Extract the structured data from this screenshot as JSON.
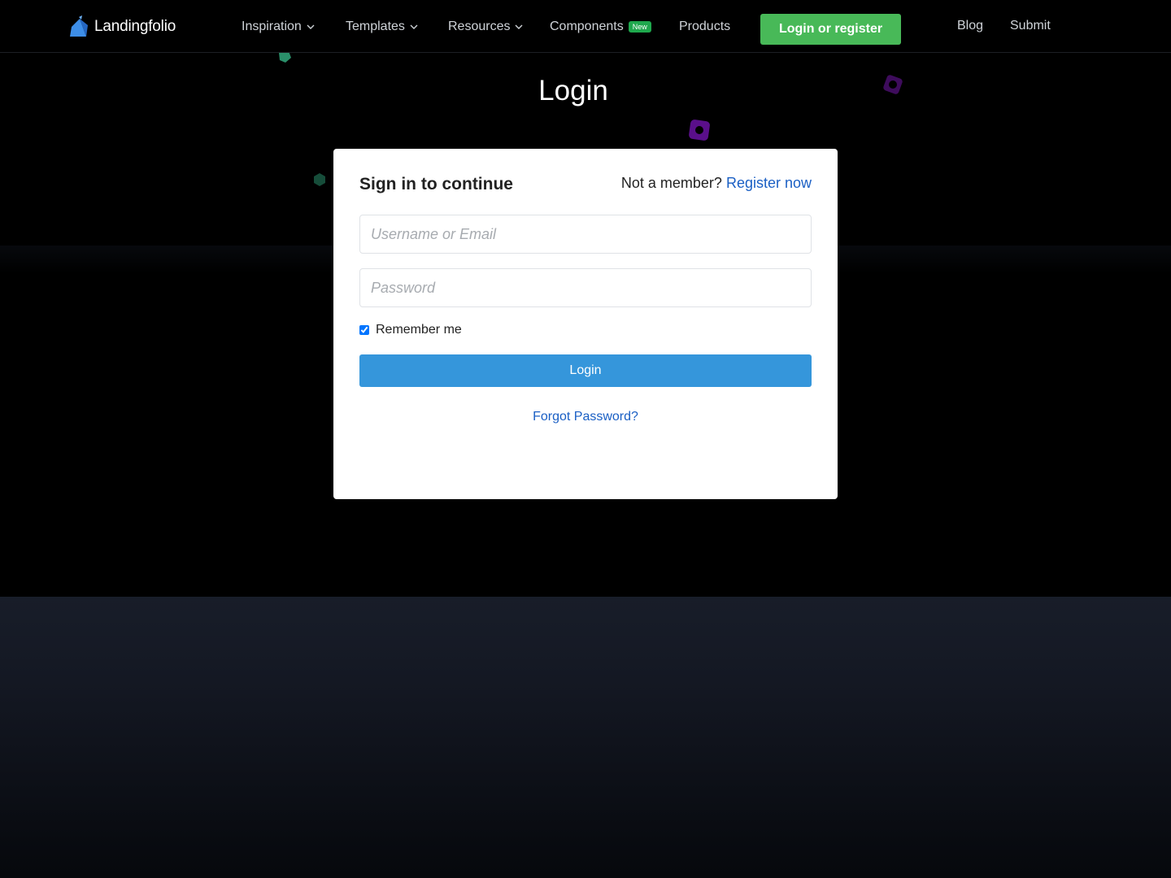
{
  "nav": {
    "logo_text": "Landingfolio",
    "items": [
      {
        "label": "Inspiration",
        "has_dropdown": true
      },
      {
        "label": "Templates",
        "has_dropdown": true
      },
      {
        "label": "Resources",
        "has_dropdown": true
      },
      {
        "label": "Components",
        "badge": "New"
      },
      {
        "label": "Products"
      }
    ],
    "cta_label": "Login or register",
    "right_links": [
      "Blog",
      "Submit"
    ]
  },
  "page": {
    "title": "Login"
  },
  "login_card": {
    "heading": "Sign in to continue",
    "member_prompt": "Not a member?",
    "register_link": "Register now",
    "username_placeholder": "Username or Email",
    "password_placeholder": "Password",
    "remember_label": "Remember me",
    "remember_checked": true,
    "submit_label": "Login",
    "forgot_link": "Forgot Password?"
  },
  "colors": {
    "cta_green": "#48b958",
    "primary_blue": "#3596db",
    "link_blue": "#1a5fc4",
    "badge_green": "#1fa84d"
  },
  "icons": [
    "logo-mark-icon",
    "chevron-down-icon"
  ]
}
